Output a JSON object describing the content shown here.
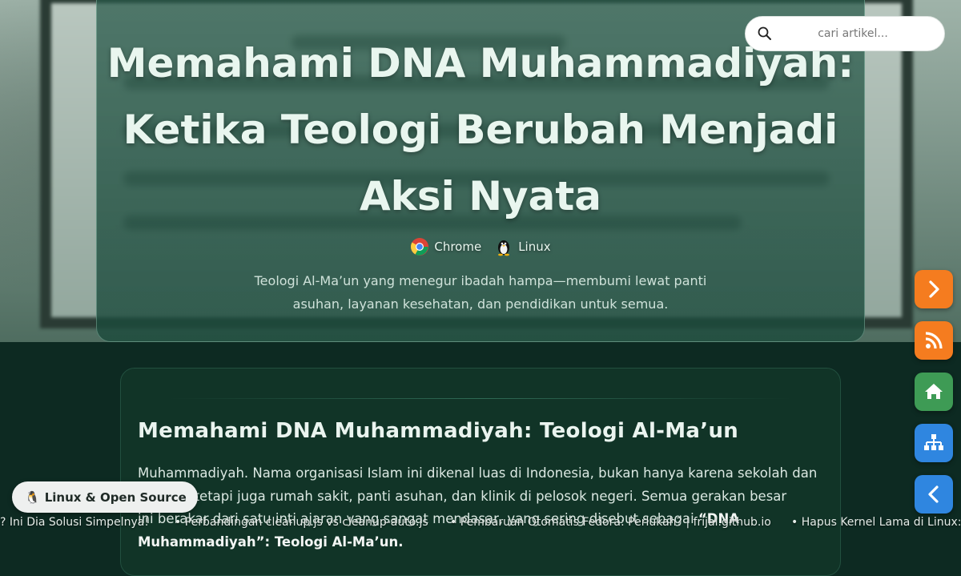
{
  "hero": {
    "title_lines": [
      "Memahami DNA Muhammadiyah:",
      "Ketika Teologi Berubah Menjadi",
      "Aksi Nyata"
    ],
    "platforms": [
      {
        "label": "Chrome",
        "icon": "chrome-icon"
      },
      {
        "label": "Linux",
        "icon": "tux-penguin-icon"
      }
    ],
    "description_lines": [
      "Teologi Al-Ma’un yang menegur ibadah hampa—membumi lewat panti",
      "asuhan, layanan kesehatan, dan pendidikan untuk semua."
    ]
  },
  "search": {
    "placeholder": "cari artikel...",
    "value": "",
    "icon": "search-icon"
  },
  "article": {
    "heading": "Memahami DNA Muhammadiyah: Teologi Al-Ma’un",
    "paragraph_lines": [
      "Muhammadiyah. Nama organisasi Islam ini dikenal luas di Indonesia, bukan hanya karena sekolah dan",
      "itasnya, tetapi juga rumah sakit, panti asuhan, dan klinik di pelosok negeri. Semua gerakan besar",
      "ini berakar dari satu inti ajaran yang sangat mendasar, yang sering disebut sebagai",
      "Muhammadiyah”: Teologi Al-Ma’un."
    ],
    "emphasis_start": "“DNA"
  },
  "side_buttons": [
    {
      "name": "next-article-button",
      "icon": "chevron-right-icon",
      "color": "#f57c1f"
    },
    {
      "name": "rss-feed-button",
      "icon": "rss-icon",
      "color": "#f57c1f"
    },
    {
      "name": "home-button",
      "icon": "home-icon",
      "color": "#3e9b55"
    },
    {
      "name": "sitemap-button",
      "icon": "sitemap-icon",
      "color": "#2f86e0"
    },
    {
      "name": "prev-article-button",
      "icon": "chevron-left-icon",
      "color": "#2f86e0"
    }
  ],
  "badge": {
    "label": "Linux & Open Source",
    "icon": "tux-penguin-icon"
  },
  "ticker": {
    "items": [
      "? Ini Dia Solusi Simpelnya!",
      "• Perbandingan cleanup.js vs cleanup-auto.js",
      "• Pembaruan Otomatis Fedora: Perlukah? | frijal.github.io",
      "• Hapus Kernel Lama di Linux:"
    ]
  },
  "colors": {
    "page_bg": "#0d2a22",
    "hero_title": "#e9f6ef",
    "orange": "#f57c1f",
    "green": "#3e9b55",
    "blue": "#2f86e0"
  }
}
